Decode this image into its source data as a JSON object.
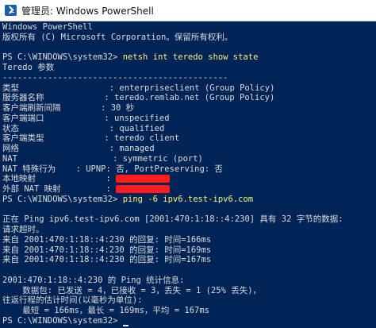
{
  "window": {
    "title": "管理员: Windows PowerShell"
  },
  "console": {
    "lines": [
      {
        "text": "Windows PowerShell"
      },
      {
        "text": "版权所有 (C) Microsoft Corporation。保留所有权利。"
      },
      {
        "text": ""
      },
      {
        "prompt": "PS C:\\WINDOWS\\system32> ",
        "cmd": "netsh int teredo show state"
      },
      {
        "text": "Teredo 参数"
      },
      {
        "text": "---------------------------------------------"
      },
      {
        "text": "类型                  : enterpriseclient (Group Policy)"
      },
      {
        "text": "服务器名称            : teredo.remlab.net (Group Policy)"
      },
      {
        "text": "客户端刷新间隔        : 30 秒"
      },
      {
        "text": "客户端端口            : unspecified"
      },
      {
        "text": "状态                  : qualified"
      },
      {
        "text": "客户端类型            : teredo client"
      },
      {
        "text": "网络                  : managed"
      },
      {
        "text": "NAT                   : symmetric (port)"
      },
      {
        "text": "NAT 特殊行为    : UPNP: 否, PortPreserving: 否"
      },
      {
        "text": "本地映射              : ",
        "redacted": true
      },
      {
        "text": "外部 NAT 映射         : ",
        "redacted": true
      },
      {
        "prompt": "PS C:\\WINDOWS\\system32> ",
        "cmd": "ping -6 ipv6.test-ipv6.com"
      },
      {
        "text": ""
      },
      {
        "text": "正在 Ping ipv6.test-ipv6.com [2001:470:1:18::4:230] 具有 32 字节的数据:"
      },
      {
        "text": "请求超时。"
      },
      {
        "text": "来自 2001:470:1:18::4:230 的回复: 时间=166ms"
      },
      {
        "text": "来自 2001:470:1:18::4:230 的回复: 时间=169ms"
      },
      {
        "text": "来自 2001:470:1:18::4:230 的回复: 时间=167ms"
      },
      {
        "text": ""
      },
      {
        "text": "2001:470:1:18::4:230 的 Ping 统计信息:"
      },
      {
        "text": "    数据包: 已发送 = 4，已接收 = 3，丢失 = 1 (25% 丢失)，"
      },
      {
        "text": "往返行程的估计时间(以毫秒为单位):"
      },
      {
        "text": "    最短 = 166ms，最长 = 169ms，平均 = 167ms"
      },
      {
        "prompt": "PS C:\\WINDOWS\\system32> ",
        "cmd": ""
      }
    ]
  },
  "colors": {
    "background": "#012456",
    "text": "#dcdcdc",
    "command": "#f7f27c",
    "redaction": "#ff1c1c"
  }
}
